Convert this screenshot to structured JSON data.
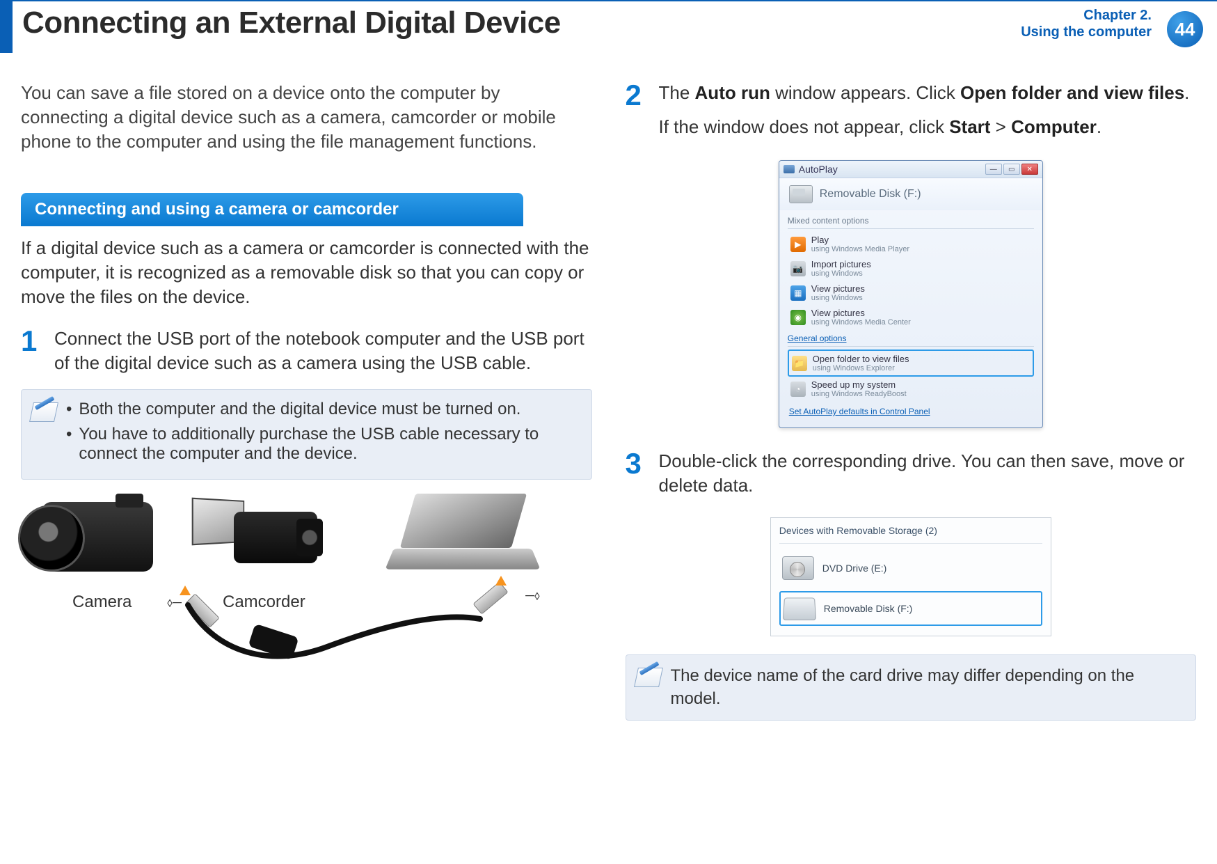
{
  "header": {
    "title": "Connecting an External Digital Device",
    "chapter_line1": "Chapter 2.",
    "chapter_line2": "Using the computer",
    "page_number": "44"
  },
  "left": {
    "intro": "You can save a file stored on a device onto the computer by connecting a digital device such as a camera, camcorder or mobile phone to the computer and using the file management functions.",
    "section_title": "Connecting and using a camera or camcorder",
    "section_body": "If a digital device such as a camera or camcorder is connected with the computer, it is recognized as a removable disk so that you can copy or move the files on the device.",
    "step1_num": "1",
    "step1_text": "Connect the USB port of the notebook computer and the USB port of the digital device such as a camera using the USB cable.",
    "notes": {
      "bullet": "•",
      "item1": "Both the computer and the digital device must be turned on.",
      "item2": "You have to additionally purchase the USB cable necessary to connect the computer and the device."
    },
    "illus": {
      "camera_label": "Camera",
      "camcorder_label": "Camcorder"
    }
  },
  "right": {
    "step2_num": "2",
    "step2_pre": "The ",
    "step2_b1": "Auto run",
    "step2_mid": " window appears. Click ",
    "step2_b2": "Open folder and view files",
    "step2_post": ".",
    "step2_line2_pre": "If the window does not appear, click ",
    "step2_line2_b1": "Start",
    "step2_line2_mid": " > ",
    "step2_line2_b2": "Computer",
    "step2_line2_post": ".",
    "autoplay": {
      "title": "AutoPlay",
      "drive": "Removable Disk (F:)",
      "section_mixed": "Mixed content options",
      "items": [
        {
          "t1": "Play",
          "t2": "using Windows Media Player"
        },
        {
          "t1": "Import pictures",
          "t2": "using Windows"
        },
        {
          "t1": "View pictures",
          "t2": "using Windows"
        },
        {
          "t1": "View pictures",
          "t2": "using Windows Media Center"
        }
      ],
      "section_general": "General options",
      "open_item": {
        "t1": "Open folder to view files",
        "t2": "using Windows Explorer"
      },
      "speed_item": {
        "t1": "Speed up my system",
        "t2": "using Windows ReadyBoost"
      },
      "footer_link": "Set AutoPlay defaults in Control Panel"
    },
    "step3_num": "3",
    "step3_text": "Double-click the corresponding drive. You can then save, move or delete data.",
    "storage": {
      "title": "Devices with Removable Storage (2)",
      "dvd": "DVD Drive (E:)",
      "removable": "Removable Disk (F:)"
    },
    "note2": "The device name of the card drive may differ depending on the model."
  }
}
